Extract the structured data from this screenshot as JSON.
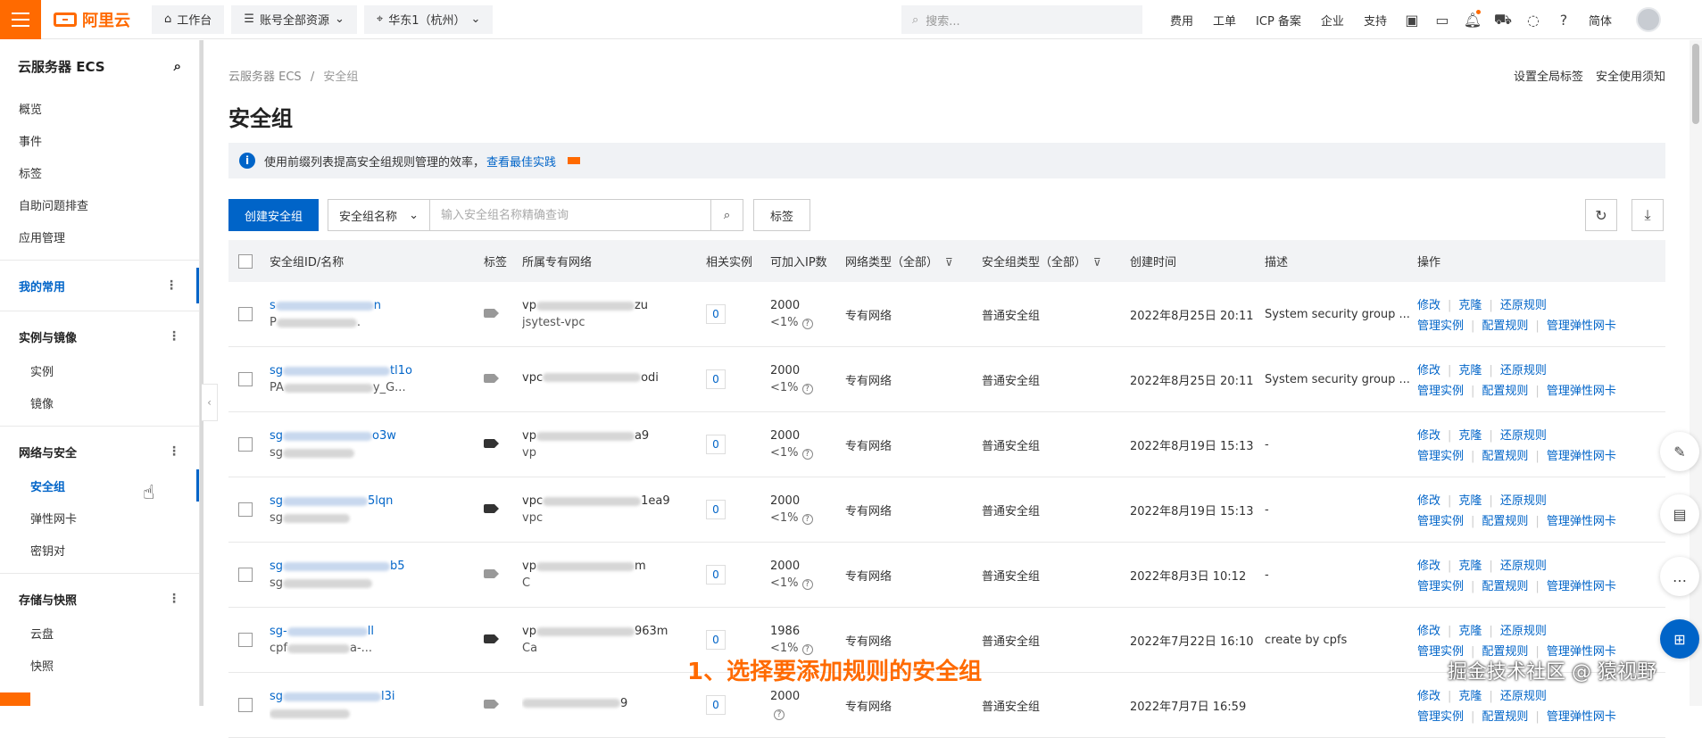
{
  "topbar": {
    "logo_text": "阿里云",
    "workbench": "工作台",
    "account_resources": "账号全部资源",
    "region": "华东1（杭州）",
    "search_placeholder": "搜索...",
    "links": [
      "费用",
      "工单",
      "ICP 备案",
      "企业",
      "支持"
    ],
    "lang": "简体"
  },
  "sidebar": {
    "title": "云服务器 ECS",
    "items": [
      "概览",
      "事件",
      "标签",
      "自助问题排查",
      "应用管理"
    ],
    "my_common": "我的常用",
    "groups": [
      {
        "label": "实例与镜像",
        "children": [
          "实例",
          "镜像"
        ]
      },
      {
        "label": "网络与安全",
        "children": [
          "安全组",
          "弹性网卡",
          "密钥对"
        ]
      },
      {
        "label": "存储与快照",
        "children": [
          "云盘",
          "快照"
        ]
      }
    ]
  },
  "breadcrumb": {
    "root": "云服务器 ECS",
    "sep": "/",
    "current": "安全组"
  },
  "top_links": [
    "设置全局标签",
    "安全使用须知"
  ],
  "page_title": "安全组",
  "alert": {
    "text": "使用前缀列表提高安全组规则管理的效率，",
    "link": "查看最佳实践"
  },
  "toolbar": {
    "create": "创建安全组",
    "select_value": "安全组名称",
    "search_placeholder": "输入安全组名称精确查询",
    "tag_button": "标签"
  },
  "table": {
    "headers": {
      "id": "安全组ID/名称",
      "tag": "标签",
      "vpc": "所属专有网络",
      "rel": "相关实例",
      "ip": "可加入IP数",
      "net_type": "网络类型（全部）",
      "sg_type": "安全组类型（全部）",
      "created": "创建时间",
      "desc": "描述",
      "ops": "操作"
    },
    "rows": [
      {
        "id_start": "s",
        "id_end": "n",
        "name_start": "P",
        "name_end": ".",
        "vpc_start": "vp",
        "vpc_end": "zu",
        "vpc2": "jsytest-vpc",
        "rel": "0",
        "ip": "2000",
        "ip_pct": "<1%",
        "net_type": "专有网络",
        "sg_type": "普通安全组",
        "created": "2022年8月25日 20:11",
        "desc": "System security group ..."
      },
      {
        "id_start": "sg",
        "id_end": "tl1o",
        "name_start": "PA",
        "name_end": "y_G...",
        "vpc_start": "vpc",
        "vpc_end": "odi",
        "vpc2": "",
        "rel": "0",
        "ip": "2000",
        "ip_pct": "<1%",
        "net_type": "专有网络",
        "sg_type": "普通安全组",
        "created": "2022年8月25日 20:11",
        "desc": "System security group ..."
      },
      {
        "id_start": "sg",
        "id_end": "o3w",
        "name_start": "sg",
        "name_end": "",
        "vpc_start": "vp",
        "vpc_end": "a9",
        "vpc2": "vp",
        "rel": "0",
        "ip": "2000",
        "ip_pct": "<1%",
        "net_type": "专有网络",
        "sg_type": "普通安全组",
        "created": "2022年8月19日 15:13",
        "desc": "-"
      },
      {
        "id_start": "sg",
        "id_end": "5lqn",
        "name_start": "sg",
        "name_end": "",
        "vpc_start": "vpc",
        "vpc_end": "1ea9",
        "vpc2": "vpc",
        "rel": "0",
        "ip": "2000",
        "ip_pct": "<1%",
        "net_type": "专有网络",
        "sg_type": "普通安全组",
        "created": "2022年8月19日 15:13",
        "desc": "-"
      },
      {
        "id_start": "sg",
        "id_end": "b5",
        "name_start": "sg",
        "name_end": "",
        "vpc_start": "vp",
        "vpc_end": "m",
        "vpc2": "C",
        "rel": "0",
        "ip": "2000",
        "ip_pct": "<1%",
        "net_type": "专有网络",
        "sg_type": "普通安全组",
        "created": "2022年8月3日 10:12",
        "desc": "-"
      },
      {
        "id_start": "sg-",
        "id_end": "ll",
        "name_start": "cpf",
        "name_end": "a-...",
        "vpc_start": "vp",
        "vpc_end": "963m",
        "vpc2": "Ca",
        "rel": "0",
        "ip": "1986",
        "ip_pct": "<1%",
        "net_type": "专有网络",
        "sg_type": "普通安全组",
        "created": "2022年7月22日 16:10",
        "desc": "create by cpfs"
      },
      {
        "id_start": "sg",
        "id_end": "l3i",
        "name_start": "",
        "name_end": "",
        "vpc_start": "",
        "vpc_end": "9",
        "vpc2": "",
        "rel": "0",
        "ip": "2000",
        "ip_pct": "",
        "net_type": "专有网络",
        "sg_type": "普通安全组",
        "created": "2022年7月7日 16:59",
        "desc": ""
      }
    ],
    "ops_line1": [
      "修改",
      "克隆",
      "还原规则"
    ],
    "ops_line2": [
      "管理实例",
      "配置规则",
      "管理弹性网卡"
    ]
  },
  "caption": "1、选择要添加规则的安全组",
  "watermark": "掘金技术社区 @ 猿视野",
  "colors": {
    "accent": "#0064c8",
    "brand": "#ff6a00"
  }
}
